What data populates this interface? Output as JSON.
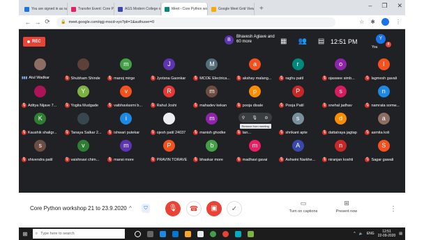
{
  "browser": {
    "tabs": [
      {
        "label": "You are signed in as rajasrokw...",
        "color": "#1a73e8",
        "active": false
      },
      {
        "label": "Transfer Event: Core Python w...",
        "color": "#e91e63",
        "active": false
      },
      {
        "label": "AGS Modern College of Engin...",
        "color": "#3949ab",
        "active": false
      },
      {
        "label": "Meet - Core Python worksh...",
        "color": "#00897b",
        "active": true
      },
      {
        "label": "Google Meet Grid View - Chro...",
        "color": "#f9ab00",
        "active": false
      }
    ],
    "new_tab": "+",
    "window_controls": [
      "–",
      "❐",
      "✕"
    ],
    "url": "meet.google.com/qgj-mscd-vyo?pli=1&authuser=0",
    "nav": [
      "←",
      "→",
      "⟳"
    ],
    "toolbar_icons": [
      "☆",
      "✱",
      "⋮"
    ]
  },
  "meet_top": {
    "rec_label": "REC",
    "presenter_initial": "B",
    "presenter_text": "Bhavesh Aglave and 60 more",
    "time": "12:51 PM",
    "you_initial": "Y",
    "you_label": "You",
    "notification_count": "8"
  },
  "participants": [
    {
      "name": "Atul Wadkar",
      "initial": "",
      "color": "#8d6e63",
      "photo": true,
      "muted": false
    },
    {
      "name": "Shubham Shinde",
      "initial": "",
      "color": "#5d4037",
      "photo": true,
      "muted": true
    },
    {
      "name": "manoj mirge",
      "initial": "m",
      "color": "#43a047",
      "photo": false,
      "muted": true
    },
    {
      "name": "Jyotsna Gaonkar",
      "initial": "J",
      "color": "#5e35b1",
      "photo": false,
      "muted": true
    },
    {
      "name": "MCOE Electrica...",
      "initial": "M",
      "color": "#546e7a",
      "photo": false,
      "muted": true
    },
    {
      "name": "akshay malang...",
      "initial": "a",
      "color": "#f4511e",
      "photo": false,
      "muted": true
    },
    {
      "name": "raghu patil",
      "initial": "r",
      "color": "#00897b",
      "photo": false,
      "muted": true
    },
    {
      "name": "ojaswee simb...",
      "initial": "o",
      "color": "#8e24aa",
      "photo": false,
      "muted": true
    },
    {
      "name": "lagmesh gavali",
      "initial": "l",
      "color": "#f4511e",
      "photo": false,
      "muted": true
    },
    {
      "name": "Aditya Nijave 7...",
      "initial": "",
      "color": "#ad1457",
      "photo": true,
      "muted": true
    },
    {
      "name": "Yogita Mudgade",
      "initial": "Y",
      "color": "#7cb342",
      "photo": false,
      "muted": true
    },
    {
      "name": "vaibhavlaxmi b...",
      "initial": "v",
      "color": "#f4511e",
      "photo": false,
      "muted": true
    },
    {
      "name": "Rahul Joshi",
      "initial": "R",
      "color": "#e53935",
      "photo": false,
      "muted": true
    },
    {
      "name": "mahadev kekan",
      "initial": "m",
      "color": "#6d4c41",
      "photo": false,
      "muted": true
    },
    {
      "name": "pooja disale",
      "initial": "p",
      "color": "#fb8c00",
      "photo": false,
      "muted": true
    },
    {
      "name": "Pooja Patil",
      "initial": "P",
      "color": "#c62828",
      "photo": false,
      "muted": true
    },
    {
      "name": "snehal jadhav",
      "initial": "s",
      "color": "#d81b60",
      "photo": false,
      "muted": true
    },
    {
      "name": "namrata somw...",
      "initial": "n",
      "color": "#1e88e5",
      "photo": false,
      "muted": true
    },
    {
      "name": "Kaushik shaligr...",
      "initial": "K",
      "color": "#2e7d32",
      "photo": false,
      "muted": true
    },
    {
      "name": "Tanaya Salkar 2...",
      "initial": "",
      "color": "#37474f",
      "photo": true,
      "muted": true
    },
    {
      "name": "ishwari putekar",
      "initial": "i",
      "color": "#1e88e5",
      "photo": false,
      "muted": true
    },
    {
      "name": "ojesh patil 24037",
      "initial": "",
      "color": "#eceff1",
      "photo": true,
      "muted": true
    },
    {
      "name": "manish ghodke",
      "initial": "m",
      "color": "#8e24aa",
      "photo": false,
      "muted": true
    },
    {
      "name": "tan...",
      "initial": "",
      "color": "#303134",
      "photo": false,
      "muted": true,
      "hover": true
    },
    {
      "name": "shrikant apte",
      "initial": "s",
      "color": "#78909c",
      "photo": false,
      "muted": true
    },
    {
      "name": "dattatraya jagtap",
      "initial": "d",
      "color": "#fb8c00",
      "photo": false,
      "muted": true
    },
    {
      "name": "asmita koli",
      "initial": "a",
      "color": "#8d6e63",
      "photo": false,
      "muted": true
    },
    {
      "name": "shivendra patil",
      "initial": "s",
      "color": "#6d4c41",
      "photo": false,
      "muted": true
    },
    {
      "name": "vaishnavi chim...",
      "initial": "v",
      "color": "#2e7d32",
      "photo": false,
      "muted": true
    },
    {
      "name": "mansi more",
      "initial": "m",
      "color": "#5e35b1",
      "photo": false,
      "muted": true
    },
    {
      "name": "PRAVIN TORAVE",
      "initial": "P",
      "color": "#f4511e",
      "photo": false,
      "muted": true
    },
    {
      "name": "bhaskar more",
      "initial": "b",
      "color": "#43a047",
      "photo": false,
      "muted": true
    },
    {
      "name": "madhavi gavai",
      "initial": "m",
      "color": "#e91e63",
      "photo": false,
      "muted": true
    },
    {
      "name": "Ashwini Narkhe...",
      "initial": "A",
      "color": "#3949ab",
      "photo": false,
      "muted": true
    },
    {
      "name": "niranjan koshti",
      "initial": "n",
      "color": "#c62828",
      "photo": false,
      "muted": true
    },
    {
      "name": "Sagar gawali",
      "initial": "S",
      "color": "#f4511e",
      "photo": false,
      "muted": true
    }
  ],
  "hover_tooltip": "Remove from meeting",
  "bottom": {
    "meeting_title": "Core Python workshop 21 to 23.9.2020",
    "caret": "^",
    "captions_label": "Turn on captions",
    "present_label": "Present now",
    "more": "⋮"
  },
  "taskbar": {
    "search_placeholder": "Type here to search",
    "tray_lang": "ENG",
    "tray_time": "12:51",
    "tray_date": "22-09-2020"
  }
}
